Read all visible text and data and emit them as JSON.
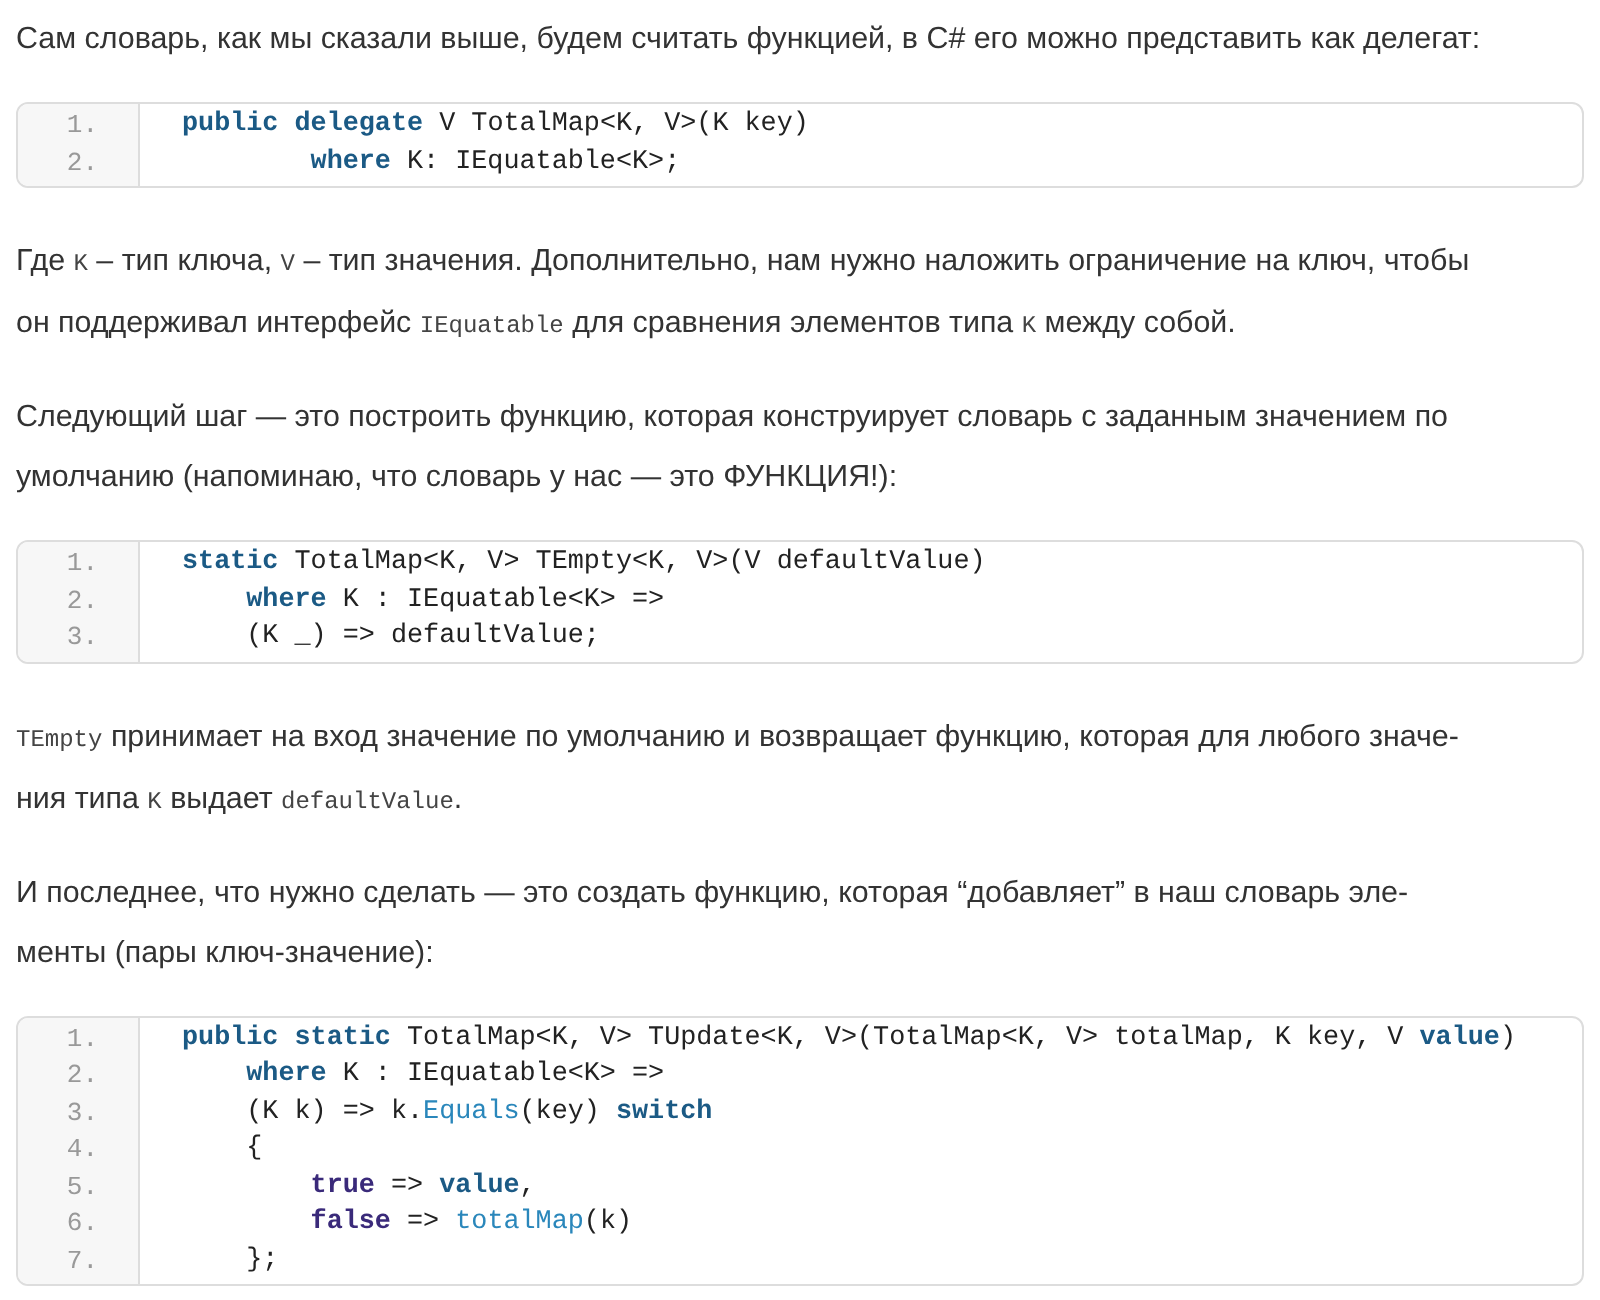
{
  "blocks": [
    {
      "kind": "paragraph",
      "lines": [
        [
          {
            "kind": "text",
            "text": "Сам словарь, как мы сказали выше, будем считать функцией, в C# его можно представить как делегат:"
          }
        ]
      ]
    },
    {
      "kind": "code",
      "lines": [
        {
          "number": "1.",
          "segments": [
            {
              "kind": "keyword",
              "text": "public delegate"
            },
            {
              "kind": "plain",
              "text": " V TotalMap<K, V>(K key)"
            }
          ]
        },
        {
          "number": "2.",
          "segments": [
            {
              "kind": "keyword",
              "text": "        where"
            },
            {
              "kind": "plain",
              "text": " K: IEquatable<K>;"
            }
          ]
        }
      ]
    },
    {
      "kind": "paragraph",
      "lines": [
        [
          {
            "kind": "text",
            "text": "Где "
          },
          {
            "kind": "code",
            "text": "K"
          },
          {
            "kind": "text",
            "text": " – тип ключа, "
          },
          {
            "kind": "code",
            "text": "V"
          },
          {
            "kind": "text",
            "text": " – тип значения. Дополнительно, нам нужно наложить ограничение на ключ, чтобы"
          }
        ],
        [
          {
            "kind": "text",
            "text": "он поддерживал интерфейс "
          },
          {
            "kind": "code",
            "text": "IEquatable"
          },
          {
            "kind": "text",
            "text": " для сравнения элементов типа "
          },
          {
            "kind": "code",
            "text": "K"
          },
          {
            "kind": "text",
            "text": " между собой."
          }
        ]
      ]
    },
    {
      "kind": "paragraph",
      "lines": [
        [
          {
            "kind": "text",
            "text": "Следующий шаг — это построить функцию, которая конструирует словарь с заданным значением по"
          }
        ],
        [
          {
            "kind": "text",
            "text": "умолчанию (напоминаю, что словарь у нас — это ФУНКЦИЯ!):"
          }
        ]
      ]
    },
    {
      "kind": "code",
      "lines": [
        {
          "number": "1.",
          "segments": [
            {
              "kind": "keyword",
              "text": "static"
            },
            {
              "kind": "plain",
              "text": " TotalMap<K, V> TEmpty<K, V>(V defaultValue)"
            }
          ]
        },
        {
          "number": "2.",
          "segments": [
            {
              "kind": "keyword",
              "text": "    where"
            },
            {
              "kind": "plain",
              "text": " K : IEquatable<K> =>"
            }
          ]
        },
        {
          "number": "3.",
          "segments": [
            {
              "kind": "plain",
              "text": "    (K _) => defaultValue;"
            }
          ]
        }
      ]
    },
    {
      "kind": "paragraph",
      "lines": [
        [
          {
            "kind": "code",
            "text": "TEmpty"
          },
          {
            "kind": "text",
            "text": " принимает на вход значение по умолчанию и возвращает функцию, которая для любого значе-"
          }
        ],
        [
          {
            "kind": "text",
            "text": "ния типа "
          },
          {
            "kind": "code",
            "text": "K"
          },
          {
            "kind": "text",
            "text": " выдает "
          },
          {
            "kind": "code",
            "text": "defaultValue"
          },
          {
            "kind": "text",
            "text": "."
          }
        ]
      ]
    },
    {
      "kind": "paragraph",
      "lines": [
        [
          {
            "kind": "text",
            "text": "И последнее, что нужно сделать — это создать функцию, которая “добавляет” в наш словарь эле-"
          }
        ],
        [
          {
            "kind": "text",
            "text": "менты (пары ключ-значение):"
          }
        ]
      ]
    },
    {
      "kind": "code",
      "lines": [
        {
          "number": "1.",
          "segments": [
            {
              "kind": "keyword",
              "text": "public static"
            },
            {
              "kind": "plain",
              "text": " TotalMap<K, V> TUpdate<K, V>(TotalMap<K, V> totalMap, K key, V "
            },
            {
              "kind": "keyword",
              "text": "value"
            },
            {
              "kind": "plain",
              "text": ")"
            }
          ]
        },
        {
          "number": "2.",
          "segments": [
            {
              "kind": "keyword",
              "text": "    where"
            },
            {
              "kind": "plain",
              "text": " K : IEquatable<K> =>"
            }
          ]
        },
        {
          "number": "3.",
          "segments": [
            {
              "kind": "plain",
              "text": "    (K k) => k."
            },
            {
              "kind": "call",
              "text": "Equals"
            },
            {
              "kind": "plain",
              "text": "(key) "
            },
            {
              "kind": "keyword",
              "text": "switch"
            }
          ]
        },
        {
          "number": "4.",
          "segments": [
            {
              "kind": "plain",
              "text": "    {"
            }
          ]
        },
        {
          "number": "5.",
          "segments": [
            {
              "kind": "literal",
              "text": "        true"
            },
            {
              "kind": "plain",
              "text": " => "
            },
            {
              "kind": "keyword",
              "text": "value"
            },
            {
              "kind": "plain",
              "text": ","
            }
          ]
        },
        {
          "number": "6.",
          "segments": [
            {
              "kind": "literal",
              "text": "        false"
            },
            {
              "kind": "plain",
              "text": " => "
            },
            {
              "kind": "call",
              "text": "totalMap"
            },
            {
              "kind": "plain",
              "text": "(k)"
            }
          ]
        },
        {
          "number": "7.",
          "segments": [
            {
              "kind": "plain",
              "text": "    };"
            }
          ]
        }
      ]
    }
  ]
}
